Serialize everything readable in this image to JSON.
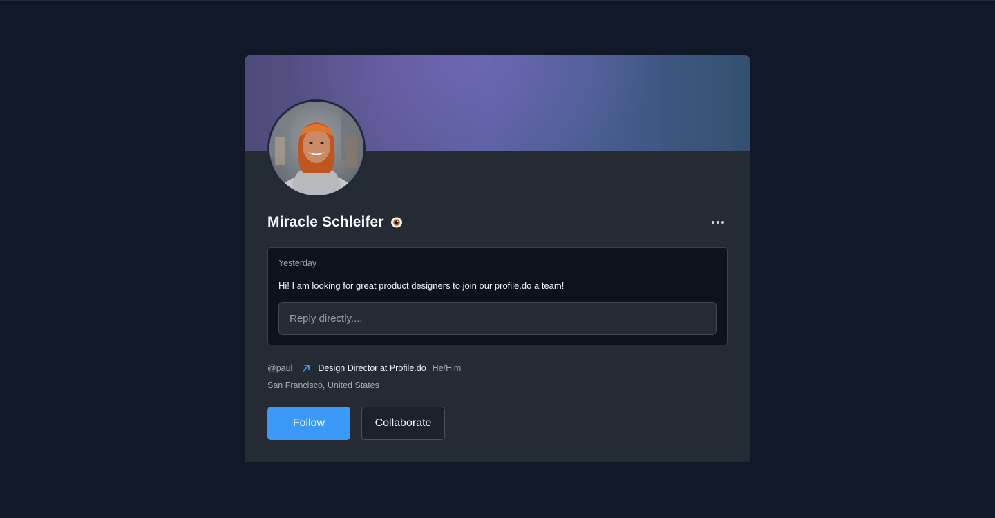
{
  "profile": {
    "name": "Miracle Schleifer",
    "status_icon": "eye-icon",
    "avatar_icon": "avatar",
    "more_icon": "more-horizontal-icon"
  },
  "message": {
    "timestamp": "Yesterday",
    "text": "Hi! I am looking for great product designers to join our profile.do a team!",
    "reply_placeholder": "Reply directly....",
    "reply_value": ""
  },
  "meta": {
    "handle": "@paul",
    "link_icon": "arrow-up-right-icon",
    "role": "Design Director at Profile.do",
    "pronouns": "He/Him",
    "location": "San Francisco, United States"
  },
  "actions": {
    "follow_label": "Follow",
    "collaborate_label": "Collaborate"
  },
  "colors": {
    "page_bg": "#111827",
    "card_bg": "#252b33",
    "message_bg": "#0d121b",
    "accent": "#3b9af7"
  }
}
